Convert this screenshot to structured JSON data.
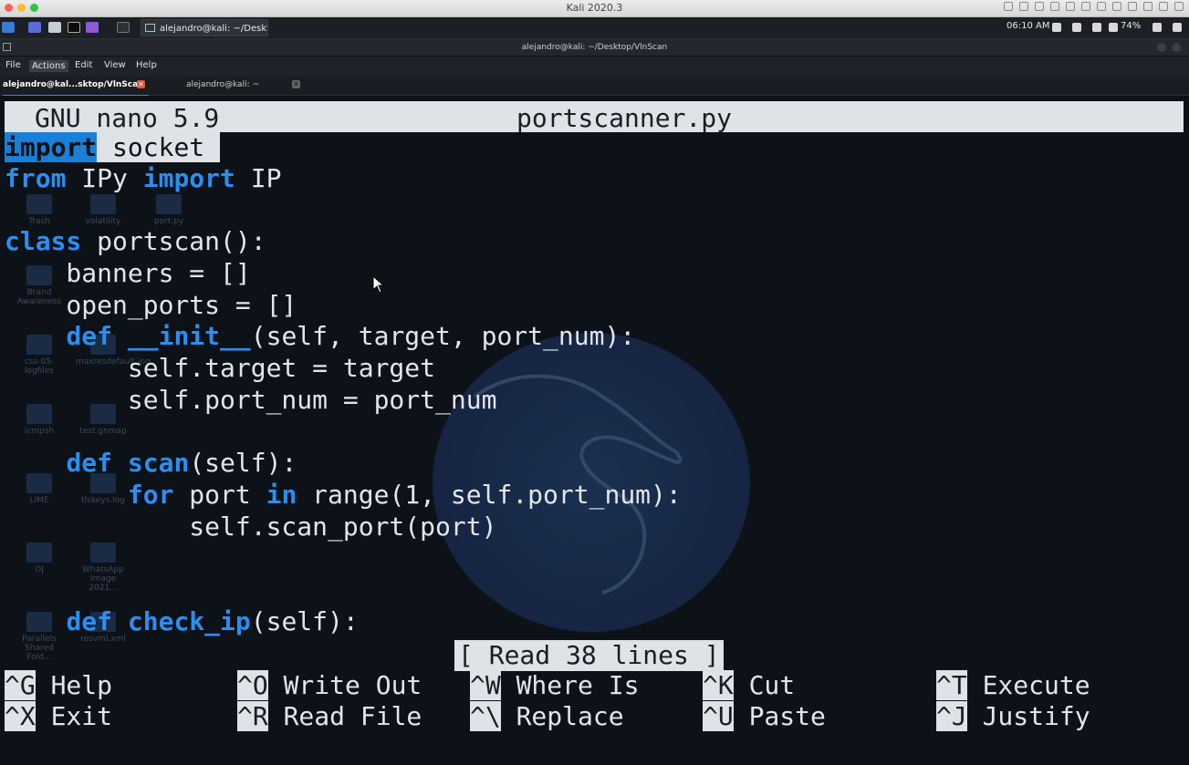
{
  "mac": {
    "title": "Kali 2020.3"
  },
  "panel": {
    "task_label": "alejandro@kali: ~/Deskt...",
    "clock": "06:10 AM",
    "battery": "74%"
  },
  "window": {
    "title": "alejandro@kali: ~/Desktop/VlnScan"
  },
  "menu": {
    "file": "File",
    "actions": "Actions",
    "edit": "Edit",
    "view": "View",
    "help": "Help"
  },
  "tabs": [
    {
      "label": "alejandro@kal...sktop/VlnScan"
    },
    {
      "label": "alejandro@kali: ~"
    }
  ],
  "nano": {
    "version": "GNU nano 5.9",
    "filename": "portscanner.py",
    "status": "[ Read 38 lines ]"
  },
  "code": {
    "l1_kw": "import",
    "l1_rest": " socket ",
    "l2_kw1": "from",
    "l2_mid": " IPy ",
    "l2_kw2": "import",
    "l2_rest": " IP",
    "l4_kw": "class",
    "l4_rest": " portscan():",
    "l5": "    banners = []",
    "l6": "    open_ports = []",
    "l7_indent": "    ",
    "l7_kw": "def",
    "l7_sp": " ",
    "l7_name": "__init__",
    "l7_rest": "(self, target, port_num):",
    "l8": "        self.target = target",
    "l9": "        self.port_num = port_num",
    "l11_indent": "    ",
    "l11_kw": "def",
    "l11_sp": " ",
    "l11_name": "scan",
    "l11_rest": "(self):",
    "l12_indent": "        ",
    "l12_kw1": "for",
    "l12_mid": " port ",
    "l12_kw2": "in",
    "l12_rest": " range(1, self.port_num):",
    "l13": "            self.scan_port(port)",
    "l16_indent": "    ",
    "l16_kw": "def",
    "l16_sp": " ",
    "l16_name": "check_ip",
    "l16_rest": "(self):"
  },
  "shortcuts": [
    {
      "key": "^G",
      "label": " Help"
    },
    {
      "key": "^X",
      "label": " Exit"
    },
    {
      "key": "^O",
      "label": " Write Out"
    },
    {
      "key": "^R",
      "label": " Read File"
    },
    {
      "key": "^W",
      "label": " Where Is"
    },
    {
      "key": "^\\",
      "label": " Replace"
    },
    {
      "key": "^K",
      "label": " Cut"
    },
    {
      "key": "^U",
      "label": " Paste"
    },
    {
      "key": "^T",
      "label": " Execute"
    },
    {
      "key": "^J",
      "label": " Justify"
    }
  ],
  "desktop_icons": [
    {
      "label": "Trash"
    },
    {
      "label": "volatility"
    },
    {
      "label": "port.py"
    },
    {
      "label": "Brand Awareness"
    },
    {
      "label": "css-05-logfiles"
    },
    {
      "label": "maxresdefault.jpg"
    },
    {
      "label": "icmpsh"
    },
    {
      "label": "test.gnmap"
    },
    {
      "label": "LIME"
    },
    {
      "label": "tlskeys.log"
    },
    {
      "label": "OJ"
    },
    {
      "label": "WhatsApp Image 2021..."
    },
    {
      "label": "Parallels Shared Fold..."
    },
    {
      "label": "resvml.xml"
    }
  ]
}
